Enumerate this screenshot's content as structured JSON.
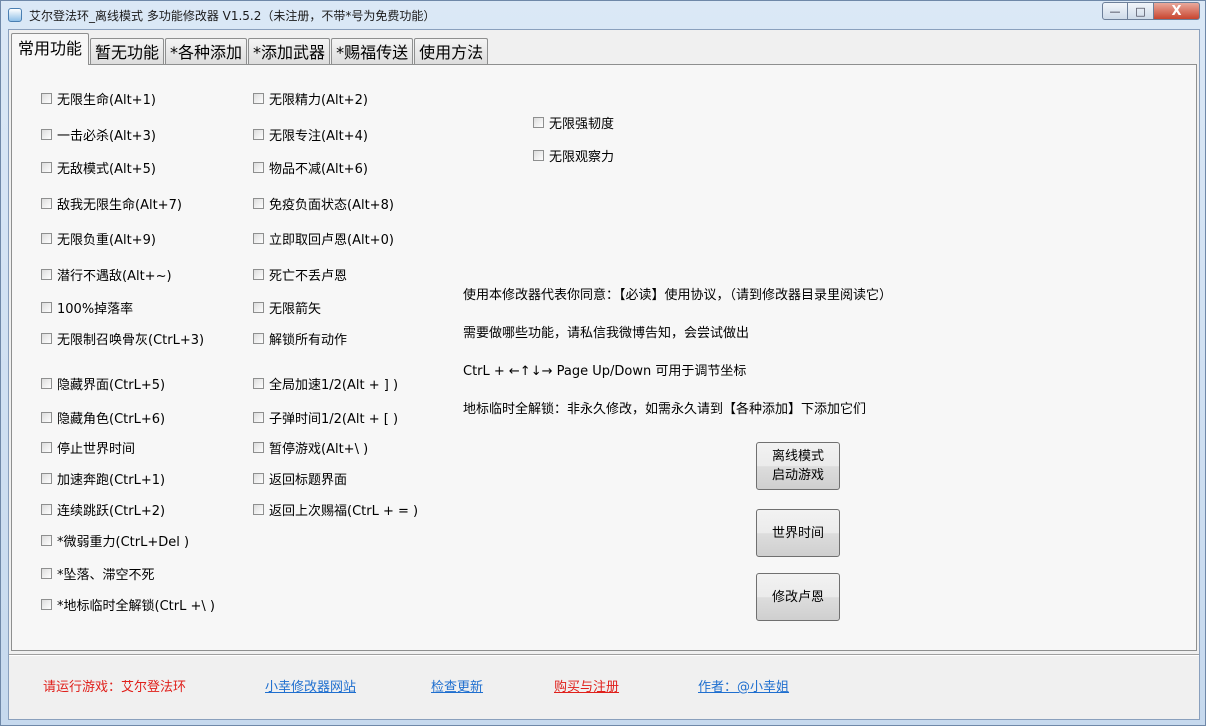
{
  "window": {
    "title": "艾尔登法环_离线模式 多功能修改器  V1.5.2（未注册，不带*号为免费功能）",
    "controls": {
      "minimize": "—",
      "maximize": "□",
      "close": "X"
    }
  },
  "tabs": [
    {
      "label": "常用功能",
      "active": true
    },
    {
      "label": "暂无功能",
      "active": false
    },
    {
      "label": "*各种添加",
      "active": false
    },
    {
      "label": "*添加武器",
      "active": false
    },
    {
      "label": "*赐福传送",
      "active": false
    },
    {
      "label": "使用方法",
      "active": false
    }
  ],
  "col1": [
    "无限生命(Alt+1)",
    "一击必杀(Alt+3)",
    "无敌模式(Alt+5)",
    "敌我无限生命(Alt+7)",
    "无限负重(Alt+9)",
    "潜行不遇敌(Alt+~)",
    "100%掉落率",
    "无限制召唤骨灰(CtrL+3)",
    "隐藏界面(CtrL+5)",
    "隐藏角色(CtrL+6)",
    "停止世界时间",
    "加速奔跑(CtrL+1)",
    "连续跳跃(CtrL+2)",
    "*微弱重力(CtrL+Del )",
    "*坠落、滞空不死",
    "*地标临时全解锁(CtrL +\\ )"
  ],
  "col2": [
    "无限精力(Alt+2)",
    "无限专注(Alt+4)",
    "物品不减(Alt+6)",
    "免疫负面状态(Alt+8)",
    "立即取回卢恩(Alt+0)",
    "死亡不丢卢恩",
    "无限箭矢",
    "解锁所有动作",
    "全局加速1/2(Alt + ] )",
    "子弹时间1/2(Alt + [ )",
    "暂停游戏(Alt+\\ )",
    "返回标题界面",
    "返回上次赐福(CtrL + = )"
  ],
  "col3": [
    "无限强韧度",
    "无限观察力"
  ],
  "info": [
    "使用本修改器代表你同意：【必读】使用协议，（请到修改器目录里阅读它）",
    "需要做哪些功能，请私信我微博告知，会尝试做出",
    "CtrL + ←↑↓→ Page Up/Down 可用于调节坐标",
    "地标临时全解锁：非永久修改，如需永久请到【各种添加】下添加它们"
  ],
  "buttons": {
    "offline_line1": "离线模式",
    "offline_line2": "启动游戏",
    "world_time": "世界时间",
    "modify_runes": "修改卢恩"
  },
  "footer": {
    "status": "请运行游戏：艾尔登法环",
    "website": "小幸修改器网站",
    "check_update": "检查更新",
    "buy_register": "购买与注册",
    "author": "作者：@小幸姐"
  },
  "colors": {
    "link_blue": "#1f6fcf",
    "alert_red": "#e0201b",
    "window_frame": "#c6d9ee"
  }
}
